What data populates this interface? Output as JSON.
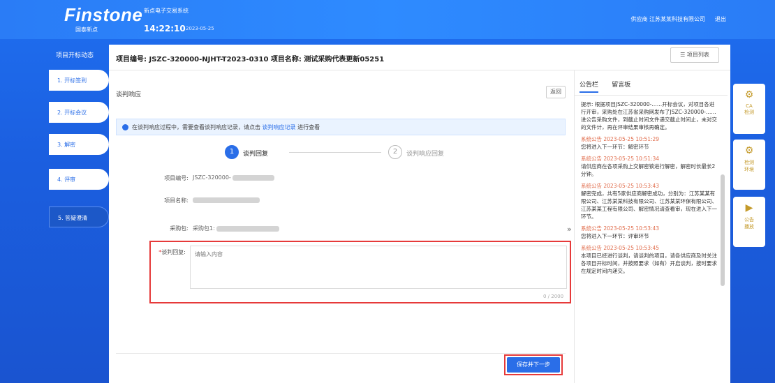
{
  "header": {
    "logo": "Finstone",
    "logo_sub": "国泰新点",
    "system_name": "新点电子交易系统",
    "clock": "14:22:10",
    "date": "2023-05-25",
    "user": "供应商 江苏某某科技有限公司",
    "logout": "退出"
  },
  "nav": {
    "title": "项目开标动态",
    "steps": [
      "1. 开标签到",
      "2. 开标会议",
      "3. 解密",
      "4. 评审",
      "5. 答疑澄清"
    ]
  },
  "project": {
    "line": "项目编号: JSZC-320000-NJHT-T2023-0310 项目名称: 测试采购代表更新05251",
    "list_button": "项目列表"
  },
  "section": {
    "title": "谈判响应",
    "back_button": "返回"
  },
  "notice": {
    "text_before": "在谈判响应过程中，需要查看谈判响应记录，请点击",
    "link": "谈判响应记录",
    "text_after": "进行查看"
  },
  "steps": {
    "step1_num": "1",
    "step1_label": "谈判回复",
    "step2_num": "2",
    "step2_label": "谈判响应回复"
  },
  "form": {
    "project_no_label": "项目编号:",
    "project_no_value": "JSZC-320000-",
    "project_name_label": "项目名称:",
    "package_label": "采购包:",
    "package_value": "采购包1:",
    "reply_required": "*",
    "reply_label": "谈判回复:",
    "reply_placeholder": "请输入内容",
    "count": "0 / 2000"
  },
  "actions": {
    "save_next": "保存并下一步"
  },
  "bulletin": {
    "tabs": [
      "公告栏",
      "留言板"
    ],
    "intro": "提示: 根据项目JSZC-320000-……开标会议，对项目各进行开审，采购处在江苏省采购网发布了JSZC-320000-……进公告采购文件，到截止时间文件递交截止时间止，未对交的文件计，再在评审结果审核再确定。",
    "entries": [
      {
        "time": "系统公告 2023-05-25 10:51:29",
        "text": "您将进入下一环节：解密环节"
      },
      {
        "time": "系统公告 2023-05-25 10:51:34",
        "text": "请供应商在各项采购上交解密锁进行解密，解密时长最长2分钟。"
      },
      {
        "time": "系统公告 2023-05-25 10:53:43",
        "text": "解密完成，共有5家供应商解密成功，分别为：江苏某某有限公司、江苏某某科技有限公司、江苏某某环保有限公司、江苏某某工程有限公司、解密情况请查看审，现在进入下一环节。"
      },
      {
        "time": "系统公告 2023-05-25 10:53:43",
        "text": "您将进入下一环节：评审环节"
      },
      {
        "time": "系统公告 2023-05-25 10:53:45",
        "text": "本项目已经进行谈判，请谈判的项目，请各供应商及时关注各项目开标时间，并按照要求（如有）开启谈判，按时要求在规定时间内递交。"
      }
    ]
  },
  "side_widgets": [
    {
      "icon": "gear-icon",
      "label": "CA\n检测"
    },
    {
      "icon": "gear-icon",
      "label": "检测\n环境"
    },
    {
      "icon": "play-icon",
      "label": "公告\n播放"
    }
  ]
}
